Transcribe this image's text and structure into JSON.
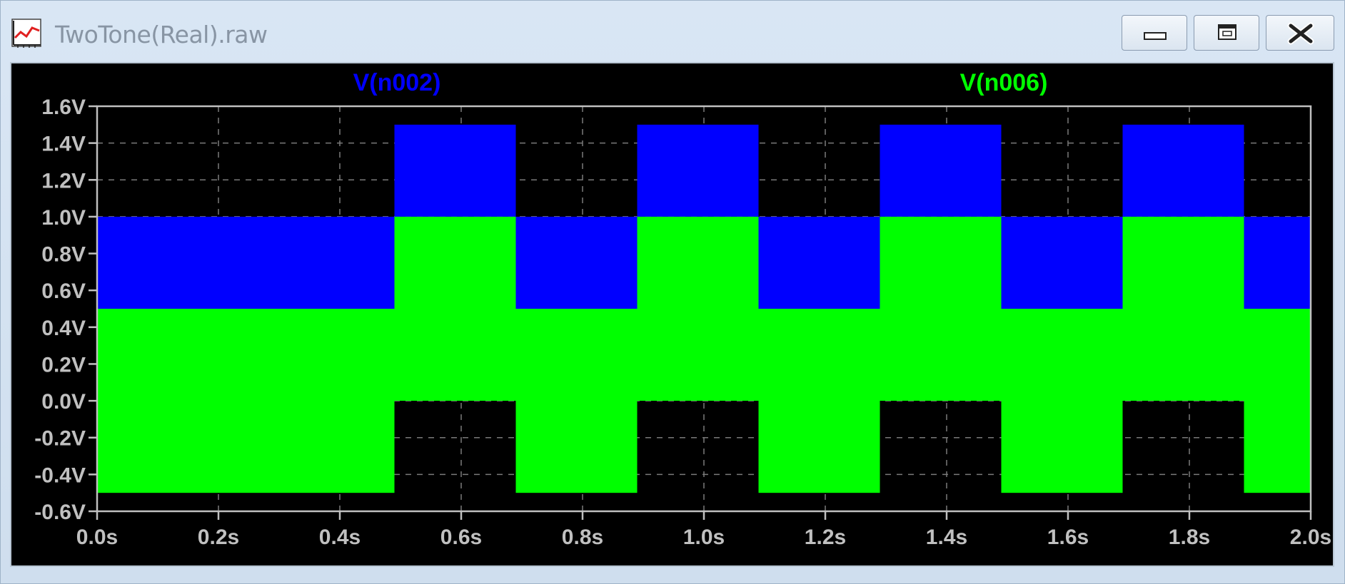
{
  "window": {
    "title": "TwoTone(Real).raw",
    "icon": "waveform-icon",
    "controls": {
      "minimize": "minimize-icon",
      "restore": "restore-icon",
      "close": "close-icon"
    }
  },
  "colors": {
    "background": "#000000",
    "series_blue": "#0000ff",
    "series_green": "#00ff00",
    "axis": "#c0c0c0"
  },
  "chart_data": {
    "type": "line",
    "title": "",
    "xlabel": "",
    "ylabel": "",
    "xlim": [
      0,
      2.0
    ],
    "ylim": [
      -0.6,
      1.6
    ],
    "x_ticks": [
      0.0,
      0.2,
      0.4,
      0.6,
      0.8,
      1.0,
      1.2,
      1.4,
      1.6,
      1.8,
      2.0
    ],
    "x_tick_labels": [
      "0.0s",
      "0.2s",
      "0.4s",
      "0.6s",
      "0.8s",
      "1.0s",
      "1.2s",
      "1.4s",
      "1.6s",
      "1.8s",
      "2.0s"
    ],
    "y_ticks": [
      1.6,
      1.4,
      1.2,
      1.0,
      0.8,
      0.6,
      0.4,
      0.2,
      0.0,
      -0.2,
      -0.4,
      -0.6
    ],
    "y_tick_labels": [
      "1.6V",
      "1.4V",
      "1.2V",
      "1.0V",
      "0.8V",
      "0.6V",
      "0.4V",
      "0.2V",
      "0.0V",
      "-0.2V",
      "-0.4V",
      "-0.6V"
    ],
    "grid": true,
    "legend": "top",
    "series": [
      {
        "name": "V(n002)",
        "color": "#0000ff",
        "bands": [
          {
            "x0": 0.0,
            "x1": 0.49,
            "ymin": 0.5,
            "ymax": 1.0
          },
          {
            "x0": 0.49,
            "x1": 0.69,
            "ymin": 1.0,
            "ymax": 1.5
          },
          {
            "x0": 0.69,
            "x1": 0.89,
            "ymin": 0.5,
            "ymax": 1.0
          },
          {
            "x0": 0.89,
            "x1": 1.09,
            "ymin": 1.0,
            "ymax": 1.5
          },
          {
            "x0": 1.09,
            "x1": 1.29,
            "ymin": 0.5,
            "ymax": 1.0
          },
          {
            "x0": 1.29,
            "x1": 1.49,
            "ymin": 1.0,
            "ymax": 1.5
          },
          {
            "x0": 1.49,
            "x1": 1.69,
            "ymin": 0.5,
            "ymax": 1.0
          },
          {
            "x0": 1.69,
            "x1": 1.89,
            "ymin": 1.0,
            "ymax": 1.5
          },
          {
            "x0": 1.89,
            "x1": 2.0,
            "ymin": 0.5,
            "ymax": 1.0
          }
        ]
      },
      {
        "name": "V(n006)",
        "color": "#00ff00",
        "bands": [
          {
            "x0": 0.0,
            "x1": 0.49,
            "ymin": -0.5,
            "ymax": 0.5
          },
          {
            "x0": 0.49,
            "x1": 0.69,
            "ymin": 0.0,
            "ymax": 1.0
          },
          {
            "x0": 0.69,
            "x1": 0.89,
            "ymin": -0.5,
            "ymax": 0.5
          },
          {
            "x0": 0.89,
            "x1": 1.09,
            "ymin": 0.0,
            "ymax": 1.0
          },
          {
            "x0": 1.09,
            "x1": 1.29,
            "ymin": -0.5,
            "ymax": 0.5
          },
          {
            "x0": 1.29,
            "x1": 1.49,
            "ymin": 0.0,
            "ymax": 1.0
          },
          {
            "x0": 1.49,
            "x1": 1.69,
            "ymin": -0.5,
            "ymax": 0.5
          },
          {
            "x0": 1.69,
            "x1": 1.89,
            "ymin": 0.0,
            "ymax": 1.0
          },
          {
            "x0": 1.89,
            "x1": 2.0,
            "ymin": -0.5,
            "ymax": 0.5
          }
        ]
      }
    ]
  }
}
